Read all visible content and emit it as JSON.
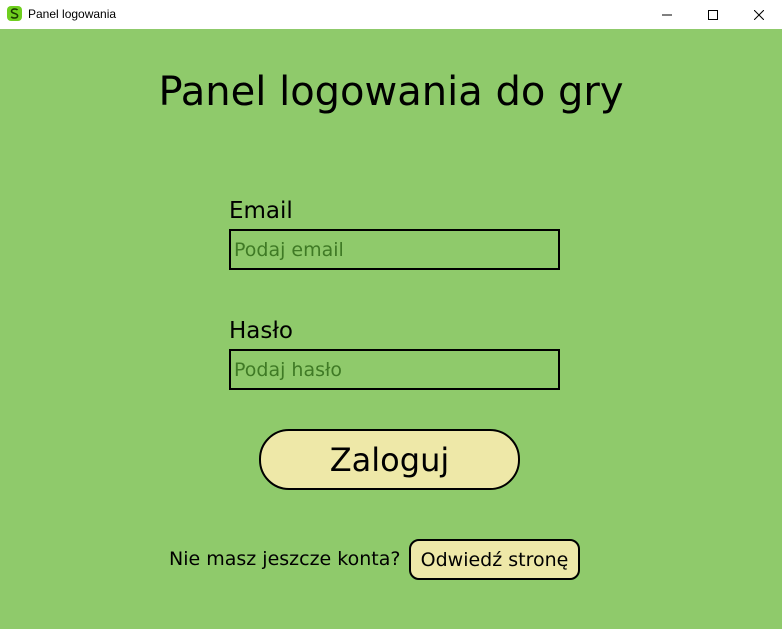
{
  "window": {
    "title": "Panel logowania",
    "icon": "app-s-icon",
    "controls": [
      "minimize-icon",
      "maximize-icon",
      "close-icon"
    ]
  },
  "main": {
    "heading": "Panel logowania do gry",
    "email_label": "Email",
    "email_placeholder": "Podaj email",
    "email_value": "",
    "password_label": "Hasło",
    "password_placeholder": "Podaj hasło",
    "password_value": "",
    "login_button": "Zaloguj",
    "register_prompt": "Nie masz jeszcze konta?",
    "visit_button": "Odwiedź stronę"
  },
  "colors": {
    "background": "#8fca6b",
    "button": "#eee8a8",
    "placeholder": "#3f7a25",
    "app_icon": "#6fcf1f"
  }
}
